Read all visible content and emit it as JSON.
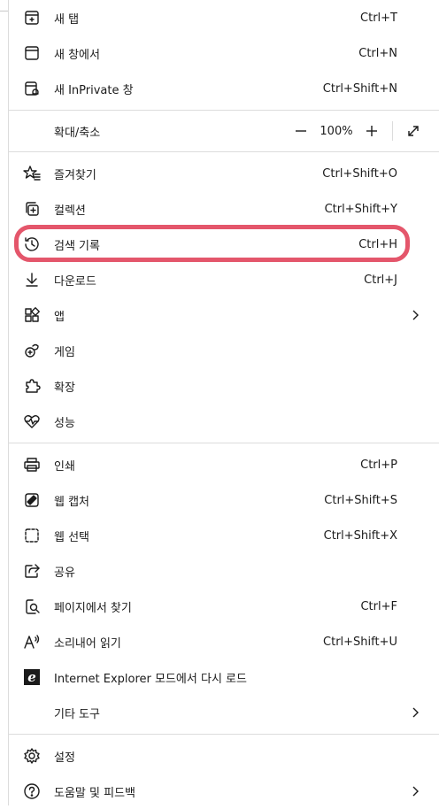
{
  "menu": {
    "new_tab": {
      "label": "새 탭",
      "shortcut": "Ctrl+T"
    },
    "new_window": {
      "label": "새 창에서",
      "shortcut": "Ctrl+N"
    },
    "new_inprivate": {
      "label": "새 InPrivate 창",
      "shortcut": "Ctrl+Shift+N"
    },
    "zoom": {
      "label": "확대/축소",
      "value": "100%"
    },
    "favorites": {
      "label": "즐겨찾기",
      "shortcut": "Ctrl+Shift+O"
    },
    "collections": {
      "label": "컬렉션",
      "shortcut": "Ctrl+Shift+Y"
    },
    "history": {
      "label": "검색 기록",
      "shortcut": "Ctrl+H"
    },
    "downloads": {
      "label": "다운로드",
      "shortcut": "Ctrl+J"
    },
    "apps": {
      "label": "앱"
    },
    "games": {
      "label": "게임"
    },
    "extensions": {
      "label": "확장"
    },
    "performance": {
      "label": "성능"
    },
    "print": {
      "label": "인쇄",
      "shortcut": "Ctrl+P"
    },
    "web_capture": {
      "label": "웹 캡처",
      "shortcut": "Ctrl+Shift+S"
    },
    "web_select": {
      "label": "웹 선택",
      "shortcut": "Ctrl+Shift+X"
    },
    "share": {
      "label": "공유"
    },
    "find": {
      "label": "페이지에서 찾기",
      "shortcut": "Ctrl+F"
    },
    "read_aloud": {
      "label": "소리내어 읽기",
      "shortcut": "Ctrl+Shift+U"
    },
    "ie_mode": {
      "label": "Internet Explorer 모드에서 다시 로드"
    },
    "more_tools": {
      "label": "기타 도구"
    },
    "settings": {
      "label": "설정"
    },
    "help": {
      "label": "도움말 및 피드백"
    }
  },
  "colors": {
    "highlight": "#e4566b",
    "separator": "#dcdcdc"
  }
}
